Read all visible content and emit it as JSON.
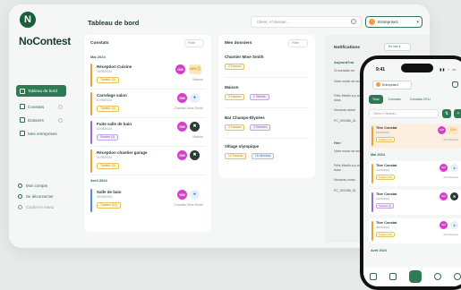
{
  "app": {
    "logo_letter": "N",
    "brand": "NoContest",
    "page_title": "Tableau de bord"
  },
  "sidebar": {
    "items": [
      {
        "label": "Tableau de bord",
        "active": true
      },
      {
        "label": "Constats"
      },
      {
        "label": "Dossiers"
      },
      {
        "label": "Mes entreprises"
      }
    ],
    "bottom": [
      {
        "label": "Mon compte"
      },
      {
        "label": "Se déconnecter"
      },
      {
        "label": "Cacher le menu"
      }
    ]
  },
  "header": {
    "search_placeholder": "Client, n°dossier...",
    "company": "Entreprise1"
  },
  "constats": {
    "title": "Constats",
    "filter": "Filtre",
    "months": [
      "Mai 2024",
      "Avril 2024"
    ],
    "entries": [
      {
        "title": "Réception Cuisine",
        "date": "15/05/2024",
        "tag": "Travaux (3)",
        "place": "Maison",
        "avatar": "GM",
        "pct": "15% ⓘ",
        "icon": ""
      },
      {
        "title": "Carrelage salon",
        "date": "07/05/2024",
        "tag": "Travaux (3)",
        "place": "Chantier Mme Smith",
        "avatar": "GM",
        "icon": "♠"
      },
      {
        "title": "Fuite salle de bain",
        "date": "02/05/2024",
        "tag": "Sinistre (3)",
        "place": "Maison",
        "avatar": "GM",
        "icon": "✖"
      },
      {
        "title": "Réception chantier garage",
        "date": "01/05/2024",
        "tag": "Travaux (3)",
        "place": "",
        "avatar": "GM",
        "icon": "✖"
      },
      {
        "title": "Salle de bain",
        "date": "30/04/2024",
        "tag": "Travaux (10)",
        "place": "Chantier Mme Smith",
        "avatar": "GM",
        "icon": "♠"
      }
    ]
  },
  "dossiers": {
    "title": "Mes dossiers",
    "filter": "Filtre",
    "items": [
      {
        "title": "Chantier Mme Smith",
        "chips": [
          "3 Travaux"
        ]
      },
      {
        "title": "Maison",
        "chips": [
          "3 Travaux",
          "1 Sinistre"
        ]
      },
      {
        "title": "Bar Champs-Élysées",
        "chips": [
          "3 Travaux",
          "3 Sinistres"
        ]
      },
      {
        "title": "Village olympique",
        "chips": [
          "15 Travaux",
          "15 Sinistres"
        ]
      }
    ]
  },
  "notifications": {
    "title": "Notifications",
    "button": "En voir ▾",
    "sections": [
      {
        "label": "Aujourd'hui",
        "lines": [
          "Ol constats en",
          "Votre mode de envoyé, modifie",
          "Félix Martin a p constat au doss",
          "Nouveau dossi",
          "FC_003456_01"
        ]
      },
      {
        "label": "Hier",
        "lines": [
          "Votre mode de envoyé, modifie",
          "Félix Martin a p constat au doss",
          "Nouveau dossi",
          "FC_003456_01"
        ]
      }
    ]
  },
  "mobile": {
    "time": "9:41",
    "company": "Entreprise1",
    "tabs": [
      "Tous",
      "Constats",
      "Constats CEU"
    ],
    "search_placeholder": "Client, n°dossier...",
    "months": [
      "Mai 2024",
      "Avril 2024"
    ],
    "entries": [
      {
        "title": "Titre Constat",
        "date": "15/05/2024",
        "tag": "Travaux (3)",
        "place": "Arch'dossiert",
        "avatar": "GM",
        "pct": "15%",
        "icon": ""
      },
      {
        "title": "Titre Constat",
        "date": "13/05/2024",
        "tag": "Travaux (3)",
        "place": "Arch'dossiert",
        "avatar": "GM",
        "icon": "♠"
      },
      {
        "title": "Titre Constat",
        "date": "10/05/2024",
        "tag": "Sinistre (3)",
        "place": "",
        "avatar": "GM",
        "icon": "✖"
      },
      {
        "title": "Titre Constat",
        "date": "08/05/2024",
        "tag": "Travaux (3)",
        "place": "Arch'dossiert",
        "avatar": "GM",
        "icon": "♠"
      }
    ]
  }
}
